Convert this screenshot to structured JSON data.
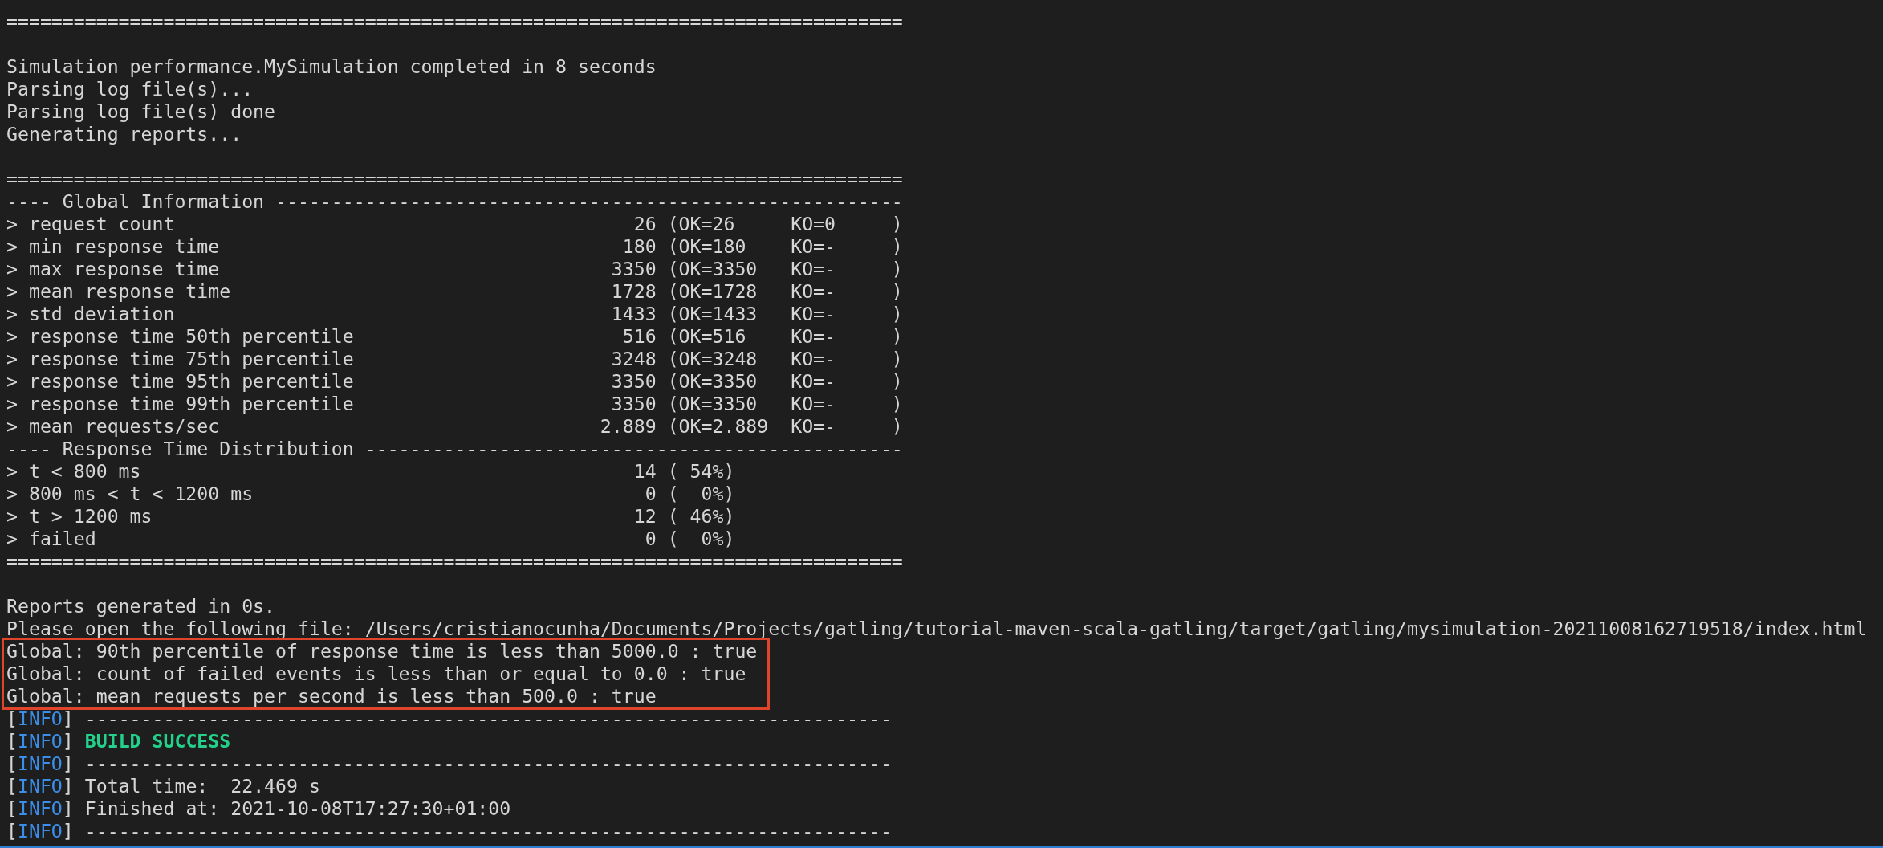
{
  "output_blocks": [
    [
      "================================================================================"
    ],
    [
      "Simulation performance.MySimulation completed in 8 seconds",
      "Parsing log file(s)...",
      "Parsing log file(s) done",
      "Generating reports..."
    ]
  ],
  "stats": {
    "top_rule": "================================================================================",
    "sections": [
      {
        "header": "---- Global Information --------------------------------------------------------",
        "rows": [
          {
            "label": "> request count",
            "value": "26",
            "detail": "(OK=26     KO=0     )"
          },
          {
            "label": "> min response time",
            "value": "180",
            "detail": "(OK=180    KO=-     )"
          },
          {
            "label": "> max response time",
            "value": "3350",
            "detail": "(OK=3350   KO=-     )"
          },
          {
            "label": "> mean response time",
            "value": "1728",
            "detail": "(OK=1728   KO=-     )"
          },
          {
            "label": "> std deviation",
            "value": "1433",
            "detail": "(OK=1433   KO=-     )"
          },
          {
            "label": "> response time 50th percentile",
            "value": "516",
            "detail": "(OK=516    KO=-     )"
          },
          {
            "label": "> response time 75th percentile",
            "value": "3248",
            "detail": "(OK=3248   KO=-     )"
          },
          {
            "label": "> response time 95th percentile",
            "value": "3350",
            "detail": "(OK=3350   KO=-     )"
          },
          {
            "label": "> response time 99th percentile",
            "value": "3350",
            "detail": "(OK=3350   KO=-     )"
          },
          {
            "label": "> mean requests/sec",
            "value": "2.889",
            "detail": "(OK=2.889  KO=-     )"
          }
        ]
      },
      {
        "header": "---- Response Time Distribution ------------------------------------------------",
        "rows": [
          {
            "label": "> t < 800 ms",
            "value": "14",
            "detail": "( 54%)"
          },
          {
            "label": "> 800 ms < t < 1200 ms",
            "value": "0",
            "detail": "(  0%)"
          },
          {
            "label": "> t > 1200 ms",
            "value": "12",
            "detail": "( 46%)"
          },
          {
            "label": "> failed",
            "value": "0",
            "detail": "(  0%)"
          }
        ]
      }
    ],
    "bottom_rule": "================================================================================"
  },
  "report_lines": [
    "Reports generated in 0s.",
    "Please open the following file: /Users/cristianocunha/Documents/Projects/gatling/tutorial-maven-scala-gatling/target/gatling/mysimulation-20211008162719518/index.html"
  ],
  "assertions_box": [
    "Global: 90th percentile of response time is less than 5000.0 : true",
    "Global: count of failed events is less than or equal to 0.0 : true",
    "Global: mean requests per second is less than 500.0 : true"
  ],
  "maven_log": [
    {
      "open": "[",
      "tag": "INFO",
      "close": "]",
      "text": "------------------------------------------------------------------------",
      "kind": "plain"
    },
    {
      "open": "[",
      "tag": "INFO",
      "close": "]",
      "text": "BUILD SUCCESS",
      "kind": "success"
    },
    {
      "open": "[",
      "tag": "INFO",
      "close": "]",
      "text": "------------------------------------------------------------------------",
      "kind": "plain"
    },
    {
      "open": "[",
      "tag": "INFO",
      "close": "]",
      "text": "Total time:  22.469 s",
      "kind": "plain"
    },
    {
      "open": "[",
      "tag": "INFO",
      "close": "]",
      "text": "Finished at: 2021-10-08T17:27:30+01:00",
      "kind": "plain"
    },
    {
      "open": "[",
      "tag": "INFO",
      "close": "]",
      "text": "------------------------------------------------------------------------",
      "kind": "plain"
    }
  ]
}
